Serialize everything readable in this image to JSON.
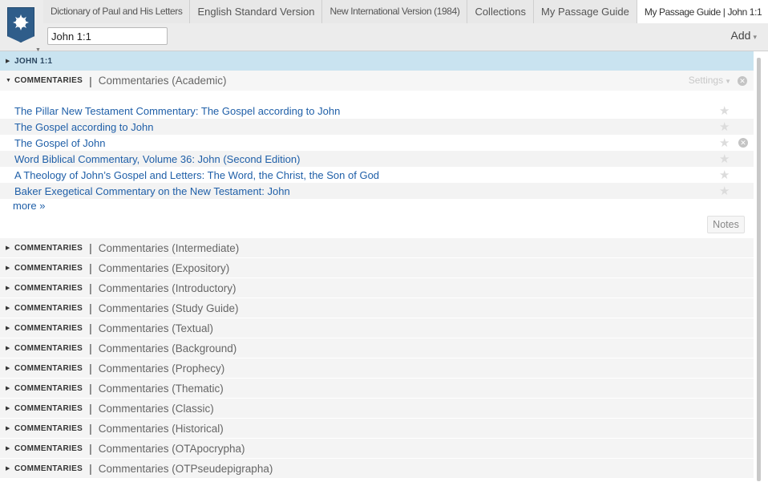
{
  "tabs": [
    {
      "label": "Dictionary of Paul and His Letters",
      "active": false
    },
    {
      "label": "English Standard Version",
      "active": false
    },
    {
      "label": "New International Version (1984)",
      "active": false
    },
    {
      "label": "Collections",
      "active": false
    },
    {
      "label": "My Passage Guide",
      "active": false
    },
    {
      "label": "My Passage Guide | John 1:1",
      "active": true
    }
  ],
  "tab_close_glyph": "×",
  "tab_add_glyph": "+",
  "reference_input": {
    "value": "John 1:1"
  },
  "add_button": {
    "label": "Add",
    "caret": "▾"
  },
  "passage": {
    "label": "JOHN 1:1"
  },
  "open_section": {
    "kind": "COMMENTARIES",
    "title": "Commentaries (Academic)",
    "settings_label": "Settings",
    "results": [
      "The Pillar New Testament Commentary: The Gospel according to John",
      "The Gospel according to John",
      "The Gospel of John",
      "Word Biblical Commentary, Volume 36: John (Second Edition)",
      "A Theology of John’s Gospel and Letters: The Word, the Christ, the Son of God",
      "Baker Exegetical Commentary on the New Testament: John"
    ],
    "more_label": "more »",
    "notes_label": "Notes"
  },
  "collapsed_sections": [
    {
      "kind": "COMMENTARIES",
      "title": "Commentaries (Intermediate)"
    },
    {
      "kind": "COMMENTARIES",
      "title": "Commentaries (Expository)"
    },
    {
      "kind": "COMMENTARIES",
      "title": "Commentaries (Introductory)"
    },
    {
      "kind": "COMMENTARIES",
      "title": "Commentaries (Study Guide)"
    },
    {
      "kind": "COMMENTARIES",
      "title": "Commentaries (Textual)"
    },
    {
      "kind": "COMMENTARIES",
      "title": "Commentaries (Background)"
    },
    {
      "kind": "COMMENTARIES",
      "title": "Commentaries (Prophecy)"
    },
    {
      "kind": "COMMENTARIES",
      "title": "Commentaries (Thematic)"
    },
    {
      "kind": "COMMENTARIES",
      "title": "Commentaries (Classic)"
    },
    {
      "kind": "COMMENTARIES",
      "title": "Commentaries (Historical)"
    },
    {
      "kind": "COMMENTARIES",
      "title": "Commentaries (OTApocrypha)"
    },
    {
      "kind": "COMMENTARIES",
      "title": "Commentaries (OTPseudepigrapha)"
    }
  ],
  "colors": {
    "brand": "#2f5d8a",
    "link": "#1f5fa8",
    "passage_bar": "#c9e3f0"
  },
  "icons": {
    "logo": "logos-seal-icon",
    "star": "star-icon",
    "remove": "circle-close-icon",
    "expand": "triangle-right-icon",
    "collapse": "triangle-down-icon"
  }
}
